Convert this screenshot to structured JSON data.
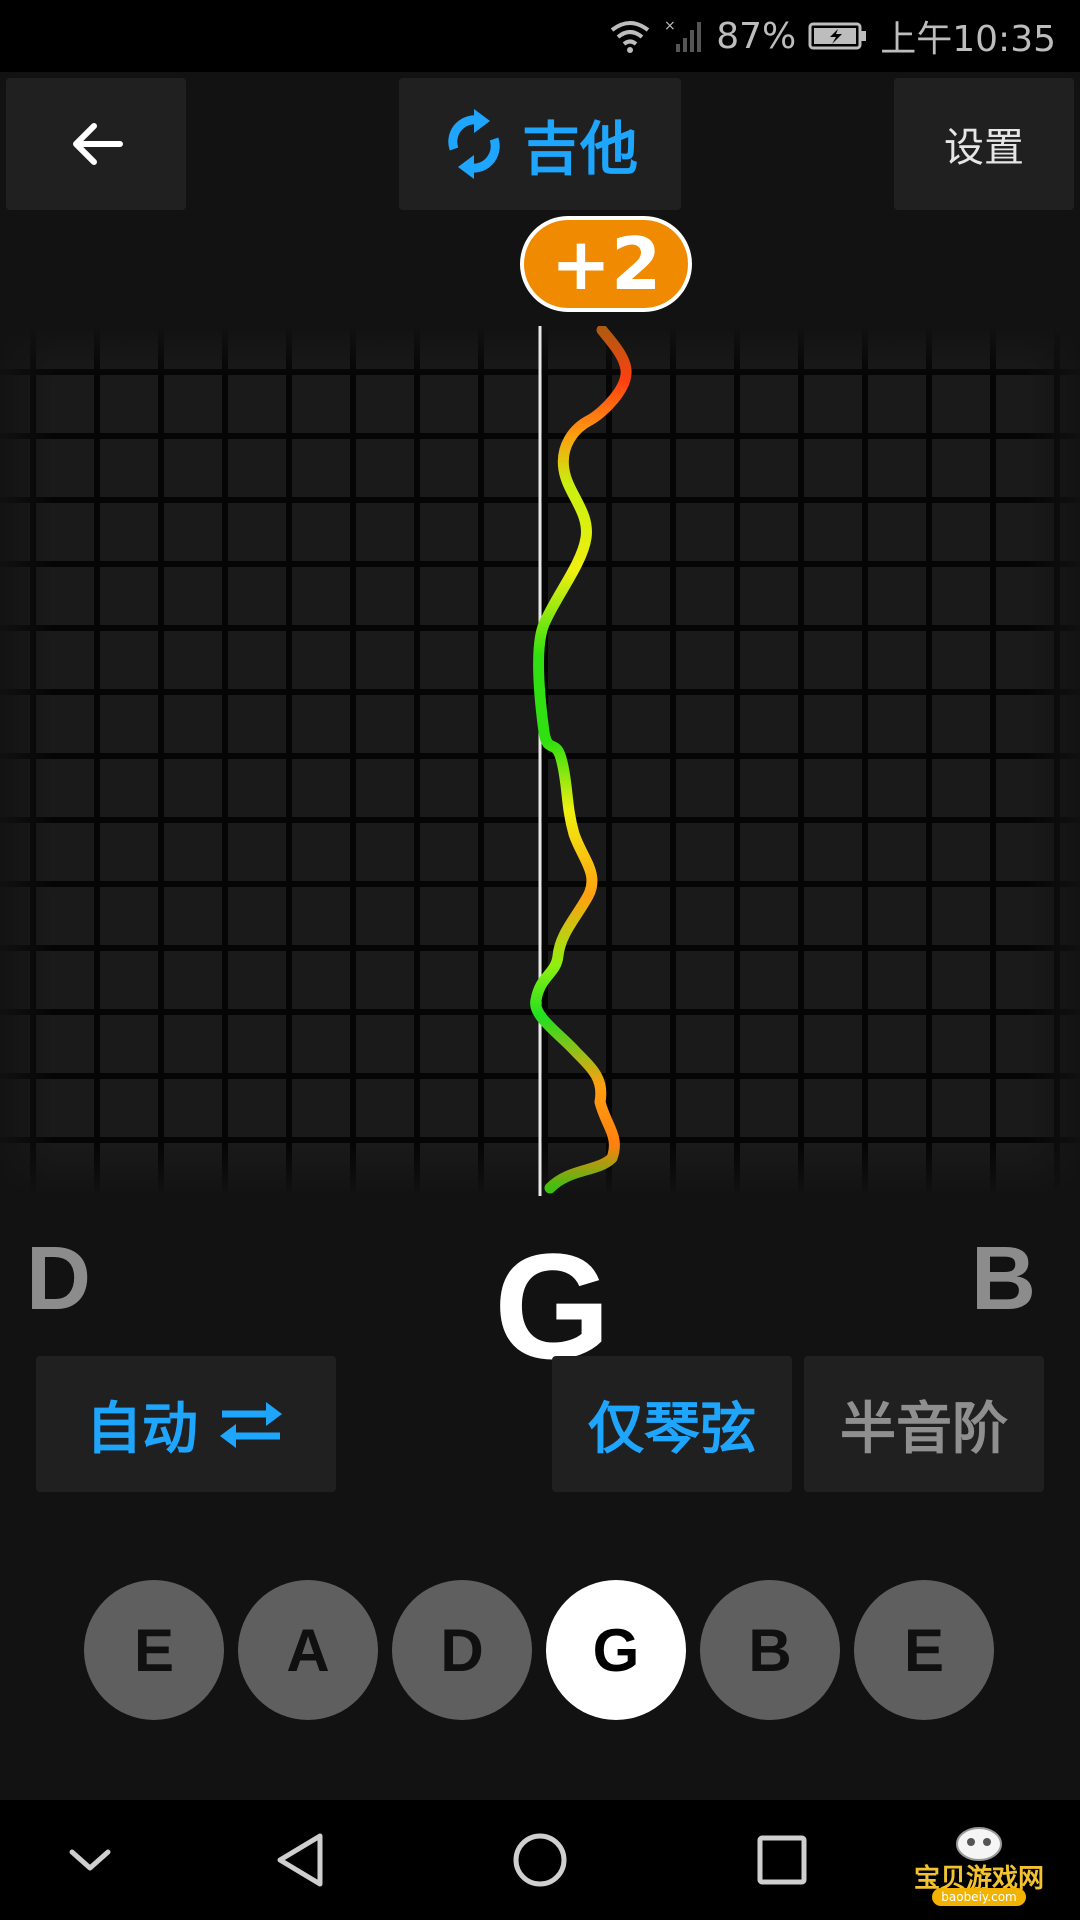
{
  "status_bar": {
    "battery": "87%",
    "time": "上午10:35"
  },
  "header": {
    "title": "吉他",
    "settings": "设置"
  },
  "tuner": {
    "cents": "+2",
    "note_left": "D",
    "note_center": "G",
    "note_right": "B"
  },
  "controls": {
    "auto": "自动",
    "strings_only": "仅琴弦",
    "chromatic": "半音阶"
  },
  "strings": [
    {
      "label": "E",
      "active": false
    },
    {
      "label": "A",
      "active": false
    },
    {
      "label": "D",
      "active": false
    },
    {
      "label": "G",
      "active": true
    },
    {
      "label": "B",
      "active": false
    },
    {
      "label": "E",
      "active": false
    }
  ],
  "watermark": {
    "name": "宝贝游戏网",
    "url": "baobeiy.com"
  },
  "colors": {
    "accent": "#1ea6ff",
    "cents_badge": "#f08a00"
  }
}
